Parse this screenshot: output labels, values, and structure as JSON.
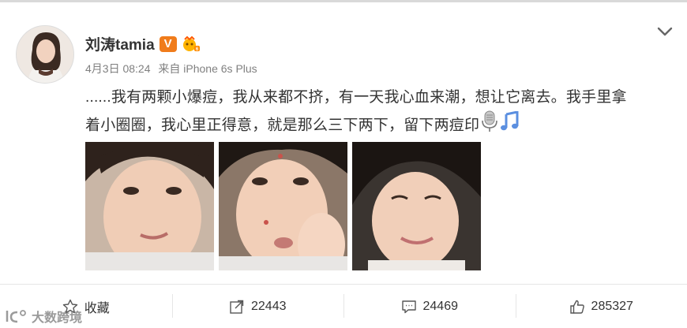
{
  "post": {
    "author": "刘涛tamia",
    "verified_badge": "V",
    "date": "4月3日 08:24",
    "source": "来自 iPhone 6s Plus",
    "text_line1": "......我有两颗小爆痘，我从来都不挤，有一天我心血来潮，想让它离去。我手里拿",
    "text_line2": "着小圈圈，我心里正得意，就是那么三下两下，留下两痘印",
    "emoji": [
      "microphone-icon",
      "music-note-icon"
    ],
    "photo_count": 3
  },
  "actions": {
    "favorite_label": "收藏",
    "repost_count": "22443",
    "comment_count": "24469",
    "like_count": "285327"
  },
  "watermark": "大数跨境",
  "colors": {
    "accent_orange": "#f07c1b",
    "text": "#333333",
    "muted": "#808080"
  }
}
